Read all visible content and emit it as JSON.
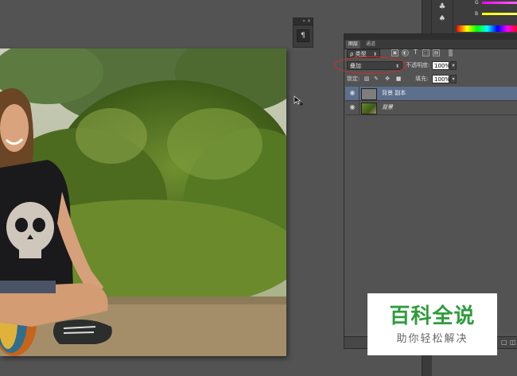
{
  "mini_panel": {
    "collapse_label": "» ×",
    "tool_glyph": "¶"
  },
  "icon_strip": {
    "icons": [
      "paint-bucket-icon",
      "bucket-icon"
    ]
  },
  "color_panel": {
    "sliders": [
      {
        "label": "G",
        "color": "#ff00ff"
      },
      {
        "label": "B",
        "color": "#ffff00"
      }
    ]
  },
  "layers_panel": {
    "tabs": [
      "图层",
      "通道"
    ],
    "filter": {
      "label": "ρ 类型",
      "icons": [
        "image-filter-icon",
        "adjustment-filter-icon",
        "type-filter-icon",
        "shape-filter-icon",
        "smart-object-filter-icon"
      ]
    },
    "blend_mode": "叠加",
    "opacity_label": "不透明度:",
    "opacity_value": "100%",
    "lock_label": "锁定:",
    "fill_label": "填充:",
    "fill_value": "100%",
    "layers": [
      {
        "name": "背景 副本",
        "selected": true,
        "italic": false
      },
      {
        "name": "背景",
        "selected": false,
        "italic": true
      }
    ]
  },
  "watermark": {
    "title": "百科全说",
    "subtitle": "助你轻松解决"
  },
  "colors": {
    "workspace": "#535353",
    "selected_layer": "#5c6f8d",
    "annotation_circle": "#e0262c",
    "watermark_green": "#2f9c3c"
  }
}
